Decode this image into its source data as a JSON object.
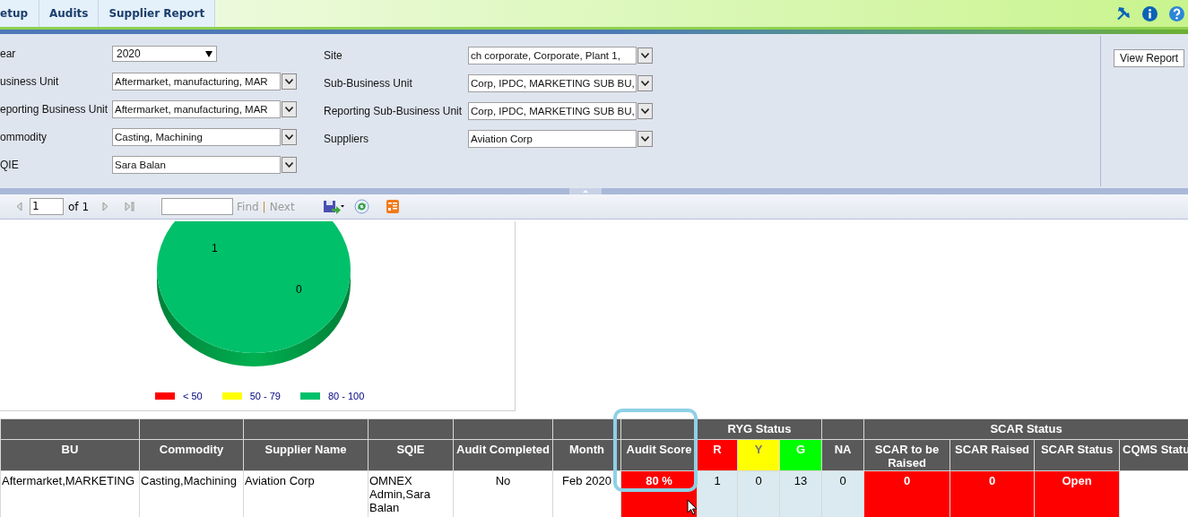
{
  "tabs": [
    {
      "label": "etup"
    },
    {
      "label": "Audits"
    },
    {
      "label": "Supplier Report"
    }
  ],
  "filters": {
    "left": [
      {
        "label": "ear",
        "value": "2020",
        "kind": "select"
      },
      {
        "label": "usiness Unit",
        "value": "Aftermarket, manufacturing, MAR",
        "kind": "multiselect"
      },
      {
        "label": "eporting Business Unit",
        "value": "Aftermarket, manufacturing, MAR",
        "kind": "multiselect"
      },
      {
        "label": "ommodity",
        "value": "Casting, Machining",
        "kind": "multiselect"
      },
      {
        "label": "QIE",
        "value": "Sara Balan",
        "kind": "multiselect"
      }
    ],
    "right": [
      {
        "label": "Site",
        "value": "ch corporate, Corporate, Plant 1,",
        "kind": "multiselect"
      },
      {
        "label": "Sub-Business Unit",
        "value": "Corp, IPDC, MARKETING SUB BU,",
        "kind": "multiselect"
      },
      {
        "label": "Reporting Sub-Business Unit",
        "value": "Corp, IPDC, MARKETING SUB BU,",
        "kind": "multiselect"
      },
      {
        "label": "Suppliers",
        "value": "Aviation Corp",
        "kind": "multiselect"
      }
    ]
  },
  "view_button": "View Report",
  "toolbar": {
    "page": "1",
    "of": "of 1",
    "find": "Find",
    "separator": "|",
    "next": "Next"
  },
  "chart": {
    "chart_data": {
      "type": "pie",
      "categories": [
        "< 50",
        "50 - 79",
        "80 - 100"
      ],
      "values": [
        0,
        0,
        1
      ],
      "colors": [
        "#ff0000",
        "#ffff00",
        "#00c06a"
      ]
    },
    "slice_labels": [
      "1",
      "0"
    ]
  },
  "table": {
    "header_groups": [
      {
        "kind": "blank"
      },
      {
        "kind": "blank"
      },
      {
        "kind": "blank"
      },
      {
        "kind": "blank"
      },
      {
        "kind": "blank"
      },
      {
        "kind": "blank"
      },
      {
        "kind": "blank"
      },
      {
        "kind": "group",
        "label": "RYG Status",
        "colspan": 3
      },
      {
        "kind": "blank"
      },
      {
        "kind": "group",
        "label": "SCAR Status",
        "colspan": 4
      }
    ],
    "columns": [
      {
        "label": "BU"
      },
      {
        "label": "Commodity"
      },
      {
        "label": "Supplier Name"
      },
      {
        "label": "SQIE"
      },
      {
        "label": "Audit Completed"
      },
      {
        "label": "Month"
      },
      {
        "label": "Audit Score"
      },
      {
        "label": "R",
        "color": "#ff0000"
      },
      {
        "label": "Y",
        "color": "#ffff00"
      },
      {
        "label": "G",
        "color": "#00ff00"
      },
      {
        "label": "NA"
      },
      {
        "label": "SCAR to be Raised"
      },
      {
        "label": "SCAR Raised"
      },
      {
        "label": "SCAR Status"
      },
      {
        "label": "CQMS Statu"
      }
    ],
    "rows": [
      {
        "cells": [
          {
            "text": "Aftermarket,MARKETING"
          },
          {
            "text": "Casting,Machining"
          },
          {
            "text": "Aviation Corp"
          },
          {
            "text": "OMNEX Admin,Sara Balan"
          },
          {
            "text": "No"
          },
          {
            "text": "Feb 2020"
          },
          {
            "text": "80 %",
            "color": "#ff0000"
          },
          {
            "text": "1",
            "color": "#daeaf0"
          },
          {
            "text": "0",
            "color": "#daeaf0"
          },
          {
            "text": "13",
            "color": "#daeaf0"
          },
          {
            "text": "0",
            "color": "#daeaf0"
          },
          {
            "text": "0",
            "color": "#ff0000"
          },
          {
            "text": "0",
            "color": "#ff0000"
          },
          {
            "text": "Open",
            "color": "#ff0000"
          },
          {}
        ]
      }
    ]
  }
}
